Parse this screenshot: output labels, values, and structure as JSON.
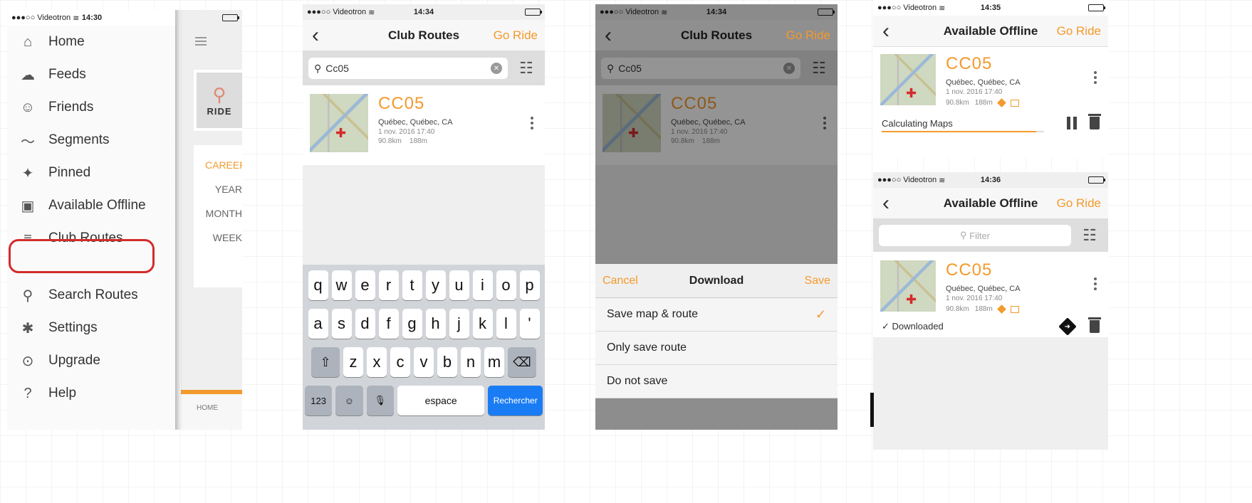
{
  "common": {
    "carrier": "Videotron",
    "signal_dots": "●●●○○",
    "back_glyph": "‹",
    "go_ride": "Go Ride"
  },
  "panel1": {
    "time": "14:30",
    "menu": [
      {
        "icon": "⌂",
        "label": "Home"
      },
      {
        "icon": "☁",
        "label": "Feeds"
      },
      {
        "icon": "☺",
        "label": "Friends"
      },
      {
        "icon": "〜",
        "label": "Segments"
      },
      {
        "icon": "✦",
        "label": "Pinned"
      },
      {
        "icon": "▣",
        "label": "Available Offline"
      },
      {
        "icon": "≡",
        "label": "Club Routes"
      }
    ],
    "menu2": [
      {
        "icon": "⚲",
        "label": "Search Routes"
      },
      {
        "icon": "✱",
        "label": "Settings"
      },
      {
        "icon": "⊙",
        "label": "Upgrade"
      },
      {
        "icon": "?",
        "label": "Help"
      }
    ],
    "ride_logo": "RIDE",
    "career": "CAREER",
    "stats_rows": [
      "YEAR",
      "MONTH",
      "WEEK"
    ],
    "tab_home": "HOME"
  },
  "panel2": {
    "time": "14:34",
    "title": "Club Routes",
    "search_value": "Cc05",
    "route": {
      "name": "CC05",
      "location": "Québec, Québec, CA",
      "date": "1 nov. 2016 17:40",
      "distance": "90.8km",
      "elevation": "188m"
    },
    "keyboard": {
      "row1": [
        "q",
        "w",
        "e",
        "r",
        "t",
        "y",
        "u",
        "i",
        "o",
        "p"
      ],
      "row2": [
        "a",
        "s",
        "d",
        "f",
        "g",
        "h",
        "j",
        "k",
        "l",
        "'"
      ],
      "row3": [
        "z",
        "x",
        "c",
        "v",
        "b",
        "n",
        "m"
      ],
      "shift": "⇧",
      "delete": "⌫",
      "num": "123",
      "emoji": "☺",
      "mic": "🎙",
      "space": "espace",
      "search": "Rechercher"
    }
  },
  "panel3": {
    "time": "14:34",
    "title": "Club Routes",
    "search_value": "Cc05",
    "route": {
      "name": "CC05",
      "location": "Québec, Québec, CA",
      "date": "1 nov. 2016 17:40",
      "distance": "90.8km",
      "elevation": "188m"
    },
    "sheet": {
      "cancel": "Cancel",
      "title": "Download",
      "save": "Save",
      "options": [
        "Save map & route",
        "Only save route",
        "Do not save"
      ],
      "selected_check": "✓"
    }
  },
  "panel4a": {
    "time": "14:35",
    "title": "Available Offline",
    "route": {
      "name": "CC05",
      "location": "Québec, Québec, CA",
      "date": "1 nov. 2016 17:40",
      "distance": "90.8km",
      "elevation": "188m"
    },
    "status": "Calculating Maps",
    "progress": 0.95
  },
  "panel4b": {
    "time": "14:36",
    "title": "Available Offline",
    "filter_placeholder": "Filter",
    "route": {
      "name": "CC05",
      "location": "Québec, Québec, CA",
      "date": "1 nov. 2016 17:40",
      "distance": "90.8km",
      "elevation": "188m"
    },
    "status": "✓ Downloaded"
  },
  "colors": {
    "accent": "#f39a2c",
    "highlight": "#d42b2b",
    "keyboard_search": "#1a7cf4"
  }
}
